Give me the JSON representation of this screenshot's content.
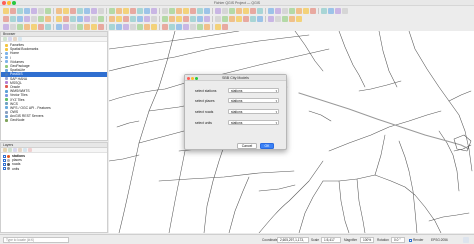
{
  "window": {
    "title": "Fichier QGIS Project — QGIS"
  },
  "colors": {
    "accent": "#2f6fd0",
    "ok_button": "#3b82f6",
    "road_line": "#555555",
    "rail_line": "#9a9a9a"
  },
  "toolbar_icons": [
    "new-project-icon",
    "open-project-icon",
    "save-project-icon",
    "save-as-icon",
    "print-layout-icon",
    "layout-manager-icon",
    "pan-icon",
    "pan-to-selection-icon",
    "zoom-in-icon",
    "zoom-out-icon",
    "zoom-full-icon",
    "zoom-selection-icon",
    "zoom-layer-icon",
    "zoom-last-icon",
    "zoom-next-icon",
    "new-bookmark-icon",
    "show-bookmarks-icon",
    "refresh-icon",
    "identify-icon",
    "select-icon",
    "deselect-icon",
    "field-calculator-icon",
    "statistics-icon",
    "measure-icon",
    "annotation-icon",
    "label-icon",
    "python-icon",
    "plugin-icon"
  ],
  "browser_panel": {
    "title": "Browser",
    "items": [
      {
        "label": "Favorites",
        "icon": "star-icon"
      },
      {
        "label": "Spatial Bookmarks",
        "icon": "bookmark-icon"
      },
      {
        "label": "Home",
        "icon": "home-folder-icon"
      },
      {
        "label": "/",
        "icon": "folder-icon"
      },
      {
        "label": "/Volumes",
        "icon": "folder-icon"
      },
      {
        "label": "GeoPackage",
        "icon": "geopackage-icon"
      },
      {
        "label": "SpatiaLite",
        "icon": "spatialite-icon"
      },
      {
        "label": "PostGIS",
        "icon": "postgis-icon"
      },
      {
        "label": "SAP HANA",
        "icon": "database-icon"
      },
      {
        "label": "MSSQL",
        "icon": "database-icon"
      },
      {
        "label": "Oracle",
        "icon": "database-icon"
      },
      {
        "label": "WMS/WMTS",
        "icon": "wms-icon"
      },
      {
        "label": "Vector Tiles",
        "icon": "vector-tiles-icon"
      },
      {
        "label": "XYZ Tiles",
        "icon": "xyz-tiles-icon"
      },
      {
        "label": "WCS",
        "icon": "wcs-icon"
      },
      {
        "label": "WFS / OGC API - Features",
        "icon": "wfs-icon"
      },
      {
        "label": "OWS",
        "icon": "ows-icon"
      },
      {
        "label": "ArcGIS REST Servers",
        "icon": "arcgis-icon"
      },
      {
        "label": "GeoNode",
        "icon": "geonode-icon"
      }
    ],
    "selected_index": 7
  },
  "layers_panel": {
    "title": "Layers",
    "items": [
      {
        "label": "stations",
        "checked": true,
        "color": "#e25822"
      },
      {
        "label": "places",
        "checked": true,
        "color": "#b0b0b0"
      },
      {
        "label": "roads",
        "checked": true,
        "color": "#555555"
      },
      {
        "label": "units",
        "checked": true,
        "color": "#8a8a8a"
      }
    ]
  },
  "dialog": {
    "title": "SBB City Models",
    "fields": [
      {
        "label": "select stations",
        "value": "stations"
      },
      {
        "label": "select places",
        "value": "stations"
      },
      {
        "label": "select roads",
        "value": "stations"
      },
      {
        "label": "select units",
        "value": "stations"
      }
    ],
    "cancel_label": "Cancel",
    "ok_label": "OK"
  },
  "statusbar": {
    "search_placeholder": "Type to locate (⌘K)",
    "coordinate_label": "Coordinate",
    "coordinate_value": "2,605,297,1,173,",
    "scale_label": "Scale",
    "scale_value": "1:5,417",
    "magnifier_label": "Magnifier",
    "magnifier_value": "100%",
    "rotation_label": "Rotation",
    "rotation_value": "0.0 °",
    "render_label": "Render",
    "crs_label": "EPSG:2056"
  }
}
